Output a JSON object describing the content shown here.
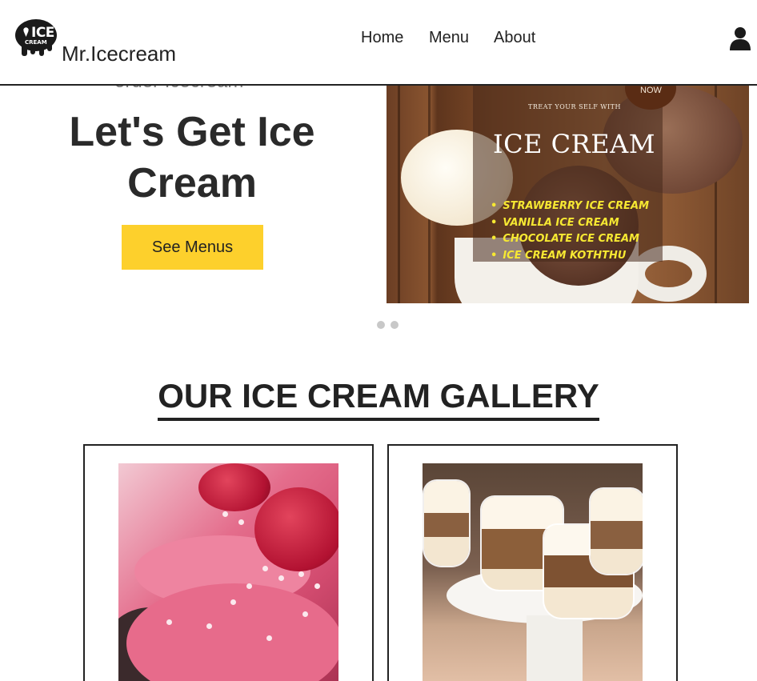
{
  "header": {
    "logo_line1": "ICE",
    "logo_line2": "CREAM",
    "brand": "Mr.Icecream",
    "nav": [
      "Home",
      "Menu",
      "About"
    ]
  },
  "hero": {
    "subtitle": "order Icecream",
    "title": "Let's Get Ice Cream",
    "cta_label": "See Menus",
    "poster": {
      "badge": "NOW",
      "tagline": "TREAT YOUR SELF WITH",
      "headline": "ICE CREAM",
      "items": [
        "STRAWBERRY ICE CREAM",
        "VANILLA ICE CREAM",
        "CHOCOLATE ICE CREAM",
        "ICE CREAM KOTHTHU"
      ]
    },
    "carousel_dots": 2
  },
  "gallery": {
    "title": "OUR ICE CREAM GALLERY",
    "items": [
      {
        "image": "raspberry-cupcake"
      },
      {
        "image": "trifle-cups"
      }
    ]
  },
  "colors": {
    "accent": "#fdd02c",
    "text": "#222222",
    "poster_list": "#f6e832"
  }
}
